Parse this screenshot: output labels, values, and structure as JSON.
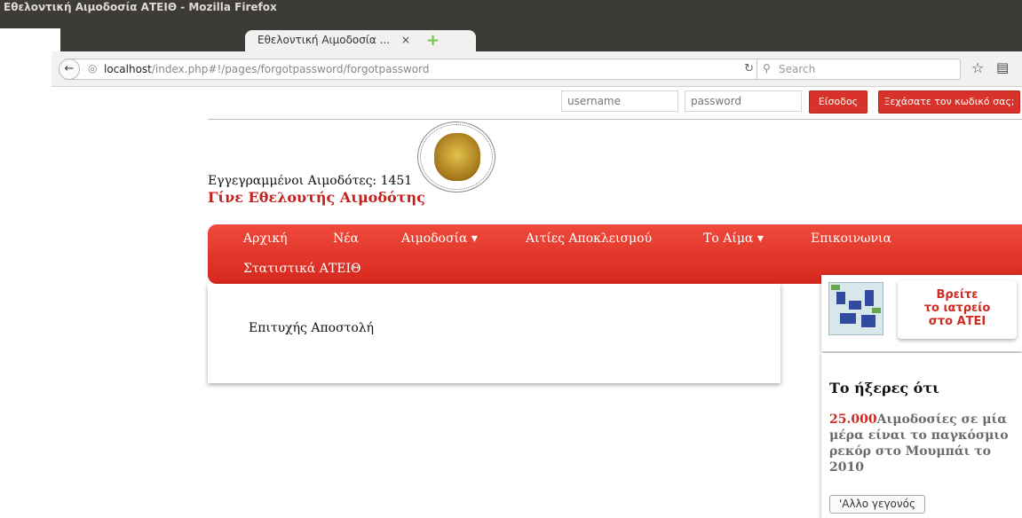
{
  "window": {
    "title": "Εθελοντική Αιμοδοσία ΑΤΕΙΘ - Mozilla Firefox"
  },
  "tab": {
    "label": "Εθελοντική Αιμοδοσία ...",
    "close": "×",
    "new_tab": "+"
  },
  "navbar": {
    "url_host": "localhost",
    "url_path": "/index.php#!/pages/forgotpassword/forgotpassword",
    "search_placeholder": "Search"
  },
  "login": {
    "username_placeholder": "username",
    "password_placeholder": "password",
    "login_label": "Είσοδος",
    "forgot_label": "Ξεχάσατε τον κωδικό σας;"
  },
  "header": {
    "donors_text": "Εγγεγραμμένοι Αιμοδότες: 1451",
    "become_text": "Γίνε Εθελουτής Αιμοδότης"
  },
  "menu": {
    "home": "Αρχική",
    "news": "Νέα",
    "donation": "Αιμοδοσία ▾",
    "exclusions": "Αιτίες Αποκλεισμού",
    "blood": "Το Αίμα ▾",
    "contact": "Επικοινωνια",
    "stats": "Στατιστικά ΑΤΕΙΘ"
  },
  "content": {
    "message": "Επιτυχής Αποστολή"
  },
  "sidebar": {
    "map_line1": "Βρείτε",
    "map_line2": "το ιατρείο",
    "map_line3": "στο ΑΤΕΙ",
    "fact_title": "Το ήξερες ότι",
    "fact_number": "25.000",
    "fact_text": "Αιμοδοσίες σε μία μέρα είναι το παγκόσμιο ρεκόρ στο Μουμπάι το 2010",
    "fact_button": "'Αλλο γεγονός"
  },
  "colors": {
    "accent": "#d8332a",
    "nav_top": "#f04a3c",
    "nav_bottom": "#d5271d",
    "title_red": "#c4201d"
  }
}
